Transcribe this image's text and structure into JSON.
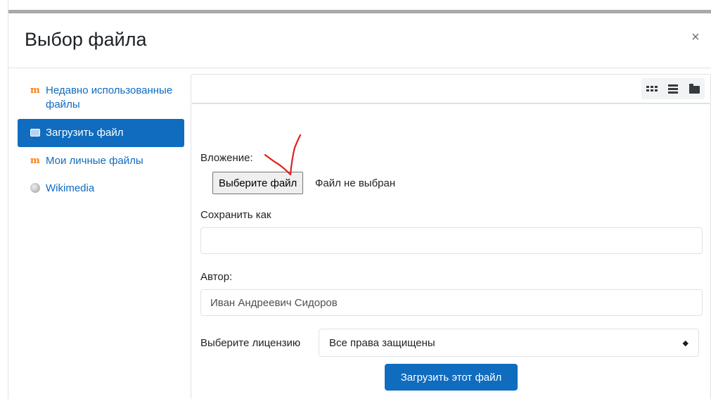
{
  "dialog": {
    "title": "Выбор файла",
    "close_glyph": "×"
  },
  "sidebar": {
    "items": [
      {
        "label": "Недавно использованные файлы",
        "icon": "moodle-icon",
        "active": false
      },
      {
        "label": "Загрузить файл",
        "icon": "upload-icon",
        "active": true
      },
      {
        "label": "Мои личные файлы",
        "icon": "moodle-icon",
        "active": false
      },
      {
        "label": "Wikimedia",
        "icon": "wikimedia-icon",
        "active": false
      }
    ]
  },
  "toolbar": {
    "views": [
      "grid-view-icon",
      "list-view-icon",
      "folder-view-icon"
    ]
  },
  "form": {
    "attachment_label": "Вложение:",
    "choose_file_button": "Выберите файл",
    "file_status": "Файл не выбран",
    "save_as_label": "Сохранить как",
    "save_as_value": "",
    "author_label": "Автор:",
    "author_value": "Иван Андреевич Сидоров",
    "license_label": "Выберите лицензию",
    "license_value": "Все права защищены",
    "submit_button": "Загрузить этот файл"
  },
  "colors": {
    "primary": "#0f6cbf",
    "moodle_orange": "#f98012",
    "annotation_red": "#e02020"
  }
}
